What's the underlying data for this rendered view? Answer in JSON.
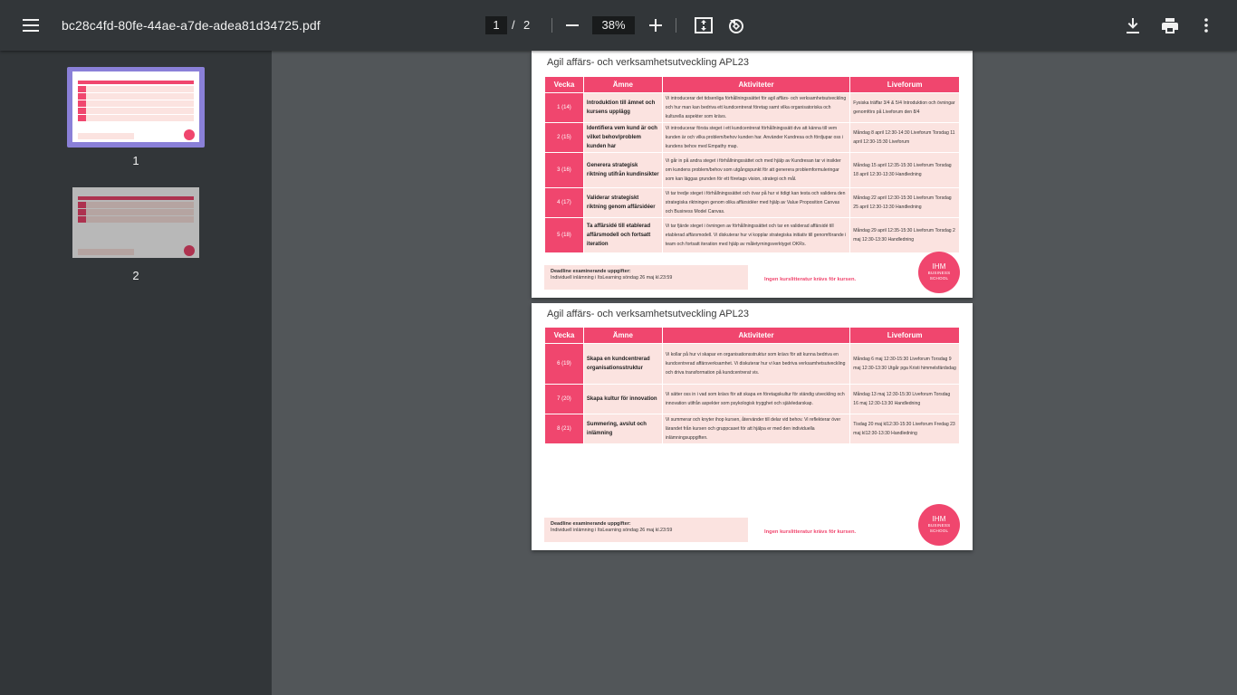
{
  "toolbar": {
    "filename": "bc28c4fd-80fe-44ae-a7de-adea81d34725.pdf",
    "current_page": "1",
    "separator": "/",
    "total_pages": "2",
    "zoom": "38%",
    "icons": [
      "menu-icon",
      "zoom-out-icon",
      "zoom-in-icon",
      "fit-page-icon",
      "rotate-icon",
      "download-icon",
      "print-icon",
      "more-vert-icon"
    ]
  },
  "sidebar": {
    "thumbnails": [
      {
        "label": "1",
        "selected": true
      },
      {
        "label": "2",
        "selected": false
      }
    ]
  },
  "document": {
    "course_title": "Agil affärs- och verksamhetsutveckling APL23",
    "headers": [
      "Vecka",
      "Ämne",
      "Aktiviteter",
      "Liveforum"
    ],
    "deadline_title": "Deadline examinerande uppgifter:",
    "deadline_text": "Individuell inlämning i ItsLearning söndag 26 maj kl.23:59",
    "no_literature": "Ingen kurslitteratur krävs för kursen.",
    "logo_line1": "IHM",
    "logo_line2": "BUSINESS",
    "logo_line3": "SCHOOL",
    "page1_rows": [
      {
        "week": "1 (14)",
        "topic": "Introduktion till ämnet och kursens upplägg",
        "activities": "Vi introducerar det tidsenliga förhållningssättet för agil affärs- och verksamhetsutveckling och hur man kan bedriva ett kundcentrerat företag samt vilka organisatoriska och kulturella aspekter som krävs.",
        "live": "Fysiska träffar 3/4 & 5/4 Introduktion och övningar genomförs på Liveforum den 8/4"
      },
      {
        "week": "2 (15)",
        "topic": "Identifiera vem kund är och vilket behov/problem kunden har",
        "activities": "Vi introducerar första steget i ett kundcentrerat förhållningssätt dvs att känna till vem kunden är och vilka problem/behov kunden har. Använder Kundresa och fördjupar oss i kundens behov med Empathy map.",
        "live": "Måndag 8 april 12:30-14:30 Liveforum Torsdag 11 april 12:30-15:30 Liveforum"
      },
      {
        "week": "3 (16)",
        "topic": "Generera strategisk riktning utifrån kundinsikter",
        "activities": "Vi går in på andra steget i förhållningssättet och med hjälp av Kundresan tar vi insikter om kundens problem/behov som utgångspunkt för att generera problemformuleringar som kan läggas grunden för ett företags vision, strategi och mål.",
        "live": "Måndag 15 april 12:35-15:30 Liveforum Torsdag 18 april 12:30-13:30 Handledning"
      },
      {
        "week": "4 (17)",
        "topic": "Validerar strategiskt riktning genom affärsidéer",
        "activities": "Vi tar tredje steget i förhållningssättet och övar på hur vi tidigt kan testa och validera den strategiska riktningen genom olika affärsidéer med hjälp av Value Proposition Canvas och Business Model Canvas.",
        "live": "Måndag 22 april 12:30-15:30 Liveforum Torsdag 25 april 12:30-13:30 Handledning"
      },
      {
        "week": "5 (18)",
        "topic": "Ta affärsidé till etablerad affärsmodell och fortsatt iteration",
        "activities": "Vi tar fjärde steget i övningen av förhållningssättet och tar en validerad affärsidé till etablerad affärsmodell. Vi diskuterar hur vi kopplar strategiska initiativ till genomförande i team och fortsatt iteration med hjälp av måletyrningsverktyget OKRs.",
        "live": "Måndag 29 april 12:35-15:30 Liveforum Torsdag 2 maj 12:30-13:30 Handledning"
      }
    ],
    "page2_rows": [
      {
        "week": "6 (19)",
        "topic": "Skapa en kundcentrerad organisationsstruktur",
        "activities": "Vi kollar på hur vi skapar en organisationsstruktur som krävs för att kunna bedriva en kundcentrerad affärsverksamhet. Vi diskuterar hur vi kan bedriva verksamhetsutveckling och driva transformation på kundcentrerat vis.",
        "live": "Måndag 6 maj 12:30-15:30 Liveforum Torsdag 9 maj 12:30-13:30 Utgår pga Kristi himmelsfärdsdag"
      },
      {
        "week": "7 (20)",
        "topic": "Skapa kultur för innovation",
        "activities": "Vi sätter oss in i vad som krävs för att skapa en företagskultur för ständig utveckling och innovation utifrån aspekter som psykologisk trygghet och självledarskap.",
        "live": "Måndag 13 maj 12:30-15:30 Liveforum Torsdag 16 maj 12:30-13:30 Handledning"
      },
      {
        "week": "8 (21)",
        "topic": "Summering, avslut och inlämning",
        "activities": "Vi summerar och knyter ihop kursen, återvänder till delar vid behov. Vi reflekterar över lärandet från kursen och gruppcaset för att hjälpa er med den individuella inlämningsuppgiften.",
        "live": "Tisdag 20 maj kl12:30-15:30 Liveforum Fredag 23 maj kl12:30-13:30 Handledning"
      }
    ]
  }
}
